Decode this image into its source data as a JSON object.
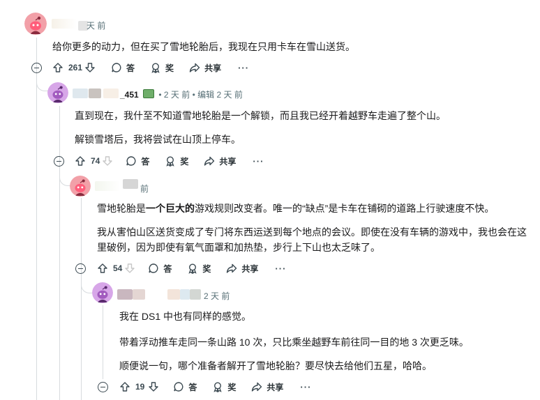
{
  "comments": [
    {
      "meta_time": "天 前",
      "lines": [
        "给你更多的动力，但在买了雪地轮胎后，我现在只用卡车在雪山送货。"
      ],
      "votes": "261",
      "reply_label": "答",
      "award_label": "奖",
      "share_label": "共享",
      "more_label": "···"
    },
    {
      "username": "_451",
      "meta_time": "• 2 天 前 • 编辑 2 天 前",
      "lines": [
        "直到现在，我什至不知道雪地轮胎是一个解锁，而且我已经开着越野车走遍了整个山。",
        "解锁雪塔后，我将尝试在山顶上停车。"
      ],
      "votes": "74",
      "reply_label": "答",
      "award_label": "奖",
      "share_label": "共享",
      "more_label": "···"
    },
    {
      "meta_time": "前",
      "line1_a": "雪地轮胎是",
      "line1_bold": "一个巨大的",
      "line1_b": "游戏规则改变者。唯一的“缺点”是卡车在铺砌的道路上行驶速度不快。",
      "line2": "我从害怕山区送货变成了专门将东西运送到每个地点的会议。即使在没有车辆的游戏中，我也会在这里破例，因为即使有氧气面罩和加热垫，步行上下山也太乏味了。",
      "votes": "54",
      "reply_label": "答",
      "award_label": "奖",
      "share_label": "共享",
      "more_label": "···"
    },
    {
      "meta_time": "2 天 前",
      "lines": [
        "我在 DS1 中也有同样的感觉。",
        "带着浮动推车走同一条山路 10 次，只比乘坐越野车前往同一目的地 3 次更乏味。",
        "顺便说一句，哪个准备者解开了雪地轮胎？要尽快去给他们五星，哈哈。"
      ],
      "votes": "19",
      "reply_label": "答",
      "award_label": "奖",
      "share_label": "共享",
      "more_label": "···"
    }
  ],
  "colors": {
    "avatar_pink": "#f2a0a8",
    "avatar_purple": "#d7a6e8",
    "text": "#1a1a1b",
    "meta": "#576f76",
    "line": "#d7dbde"
  }
}
